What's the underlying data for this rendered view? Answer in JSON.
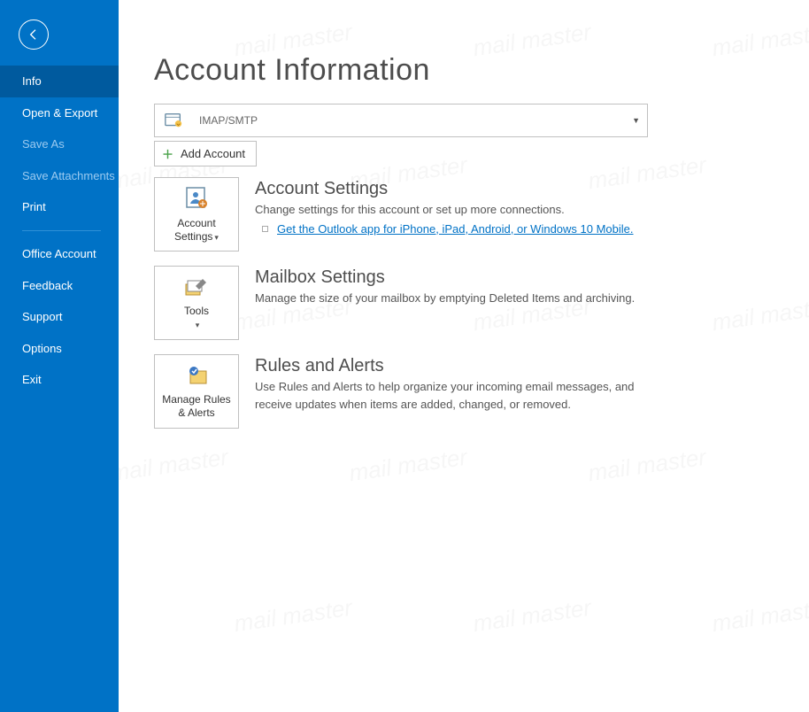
{
  "sidebar": {
    "items": [
      {
        "label": "Info",
        "selected": true
      },
      {
        "label": "Open & Export"
      },
      {
        "label": "Save As",
        "disabled": true
      },
      {
        "label": "Save Attachments",
        "disabled": true
      },
      {
        "label": "Print"
      }
    ],
    "bottom_items": [
      {
        "label": "Office Account"
      },
      {
        "label": "Feedback"
      },
      {
        "label": "Support"
      },
      {
        "label": "Options"
      },
      {
        "label": "Exit"
      }
    ]
  },
  "page": {
    "title": "Account Information",
    "account_type": "IMAP/SMTP",
    "add_account": "Add Account"
  },
  "sections": {
    "account_settings": {
      "btn": "Account Settings",
      "title": "Account Settings",
      "desc": "Change settings for this account or set up more connections.",
      "link": "Get the Outlook app for iPhone, iPad, Android, or Windows 10 Mobile."
    },
    "mailbox": {
      "btn": "Tools",
      "title": "Mailbox Settings",
      "desc": "Manage the size of your mailbox by emptying Deleted Items and archiving."
    },
    "rules": {
      "btn": "Manage Rules & Alerts",
      "title": "Rules and Alerts",
      "desc": "Use Rules and Alerts to help organize your incoming email messages, and receive updates when items are added, changed, or removed."
    }
  }
}
